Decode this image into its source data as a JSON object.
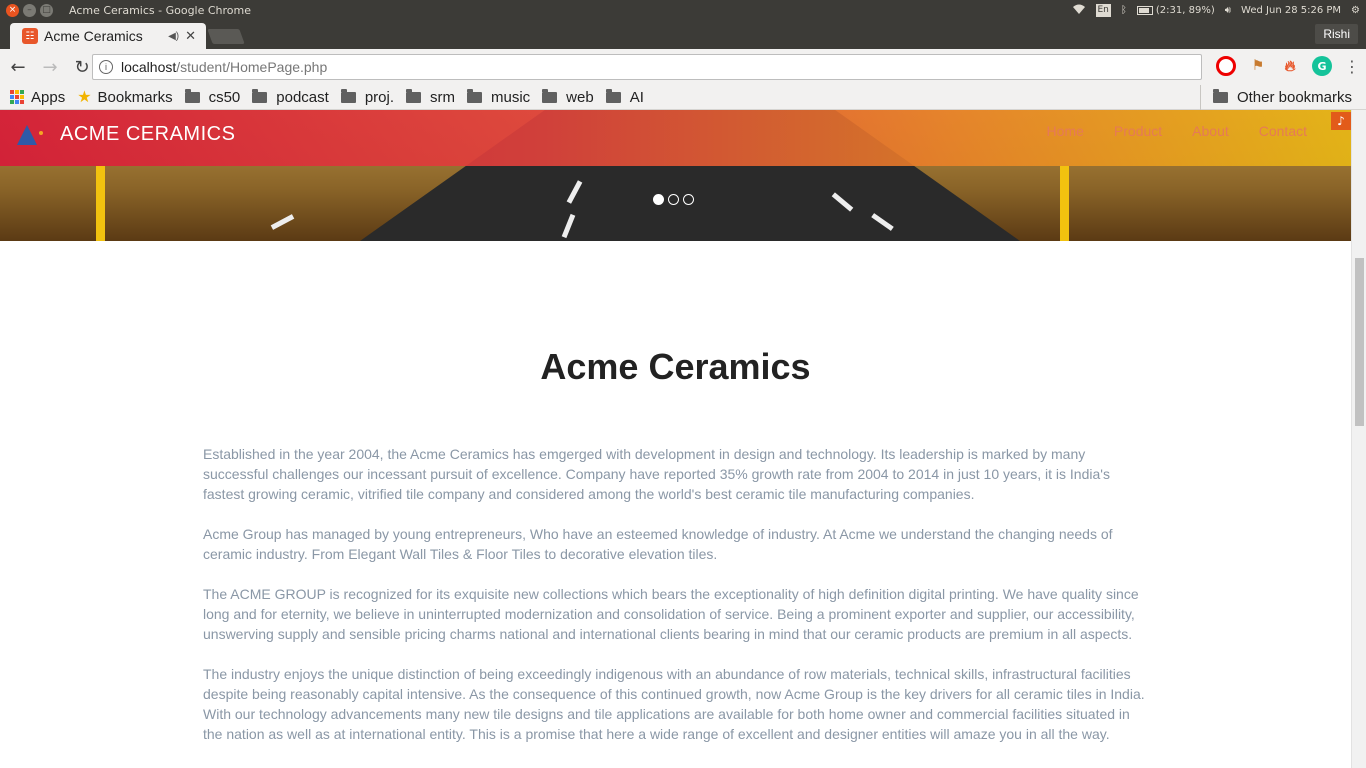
{
  "os": {
    "window_title": "Acme Ceramics - Google Chrome",
    "lang": "En",
    "battery": "(2:31, 89%)",
    "clock": "Wed Jun 28  5:26 PM"
  },
  "browser": {
    "tab_title": "Acme Ceramics",
    "profile": "Rishi",
    "url_host": "localhost",
    "url_path": "/student/HomePage.php"
  },
  "bookmarks": {
    "apps": "Apps",
    "items": [
      "Bookmarks",
      "cs50",
      "podcast",
      "proj.",
      "srm",
      "music",
      "web",
      "AI"
    ],
    "other": "Other bookmarks"
  },
  "site": {
    "brand": "ACME CERAMICS",
    "nav": [
      "Home",
      "Product",
      "About",
      "Contact"
    ],
    "heading": "Acme Ceramics",
    "paragraphs": [
      "Established in the year 2004, the Acme Ceramics has emgerged with development in design and technology. Its leadership is marked by many successful challenges our incessant pursuit of excellence. Company have reported 35% growth rate from 2004 to 2014 in just 10 years, it is India's fastest growing ceramic, vitrified tile company and considered among the world's best ceramic tile manufacturing companies.",
      "Acme Group has managed by young entrepreneurs, Who have an esteemed knowledge of industry. At Acme we understand the changing needs of ceramic industry. From Elegant Wall Tiles & Floor Tiles to decorative elevation tiles.",
      "The ACME GROUP is recognized for its exquisite new collections which bears the exceptionality of high definition digital printing. We have quality since long and for eternity, we believe in uninterrupted modernization and consolidation of service. Being a prominent exporter and supplier, our accessibility, unswerving supply and sensible pricing charms national and international clients bearing in mind that our ceramic products are premium in all aspects.",
      "The industry enjoys the unique distinction of being exceedingly indigenous with an abundance of row materials, technical skills, infrastructural facilities despite being reasonably capital intensive. As the consequence of this continued growth, now Acme Group is the key drivers for all ceramic tiles in India. With our technology advancements many new tile designs and tile applications are available for both home owner and commercial facilities situated in the nation as well as at international entity. This is a promise that here a wide range of excellent and designer entities will amaze you in all the way."
    ],
    "slider_active": 1,
    "slider_count": 3
  }
}
